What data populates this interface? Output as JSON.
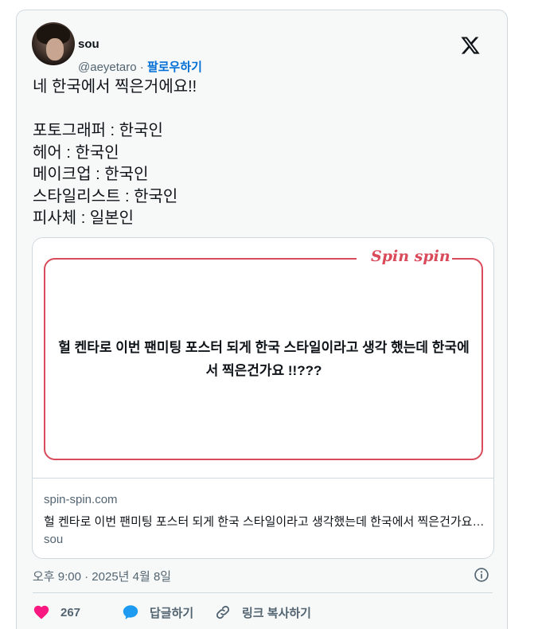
{
  "author": {
    "name": "sou",
    "handle": "@aeyetaro",
    "separator": "·",
    "follow_label": "팔로우하기"
  },
  "tweet": {
    "text": "네 한국에서 찍은거에요!!\n\n포토그래퍼 : 한국인\n헤어 : 한국인\n메이크업 : 한국인\n스타일리스트 : 한국인\n피사체 : 일본인"
  },
  "link_card": {
    "brand": "Spin spin",
    "poster_text": "헐 켄타로 이번 팬미팅 포스터 되게 한국 스타일이라고 생각 했는데 한국에서 찍은건가요 !!???",
    "domain": "spin-spin.com",
    "description": "헐 켄타로 이번 팬미팅 포스터 되게 한국 스타일이라고 생각했는데 한국에서 찍은건가요 !!???",
    "author": "sou"
  },
  "meta": {
    "timestamp": "오후 9:00 · 2025년 4월 8일"
  },
  "actions": {
    "like_count": "267",
    "reply_label": "답글하기",
    "copy_link_label": "링크 복사하기"
  },
  "icons": {
    "x_logo": "x-logo-icon",
    "info": "info-icon",
    "heart": "heart-icon",
    "reply": "speech-bubble-icon",
    "link": "chain-link-icon"
  },
  "colors": {
    "follow_blue": "#006fd6",
    "heart_pink": "#f91880",
    "reply_blue": "#1d9bf0",
    "brand_red": "#d94a5a",
    "muted_text": "#536471",
    "border": "#cfd9de"
  }
}
